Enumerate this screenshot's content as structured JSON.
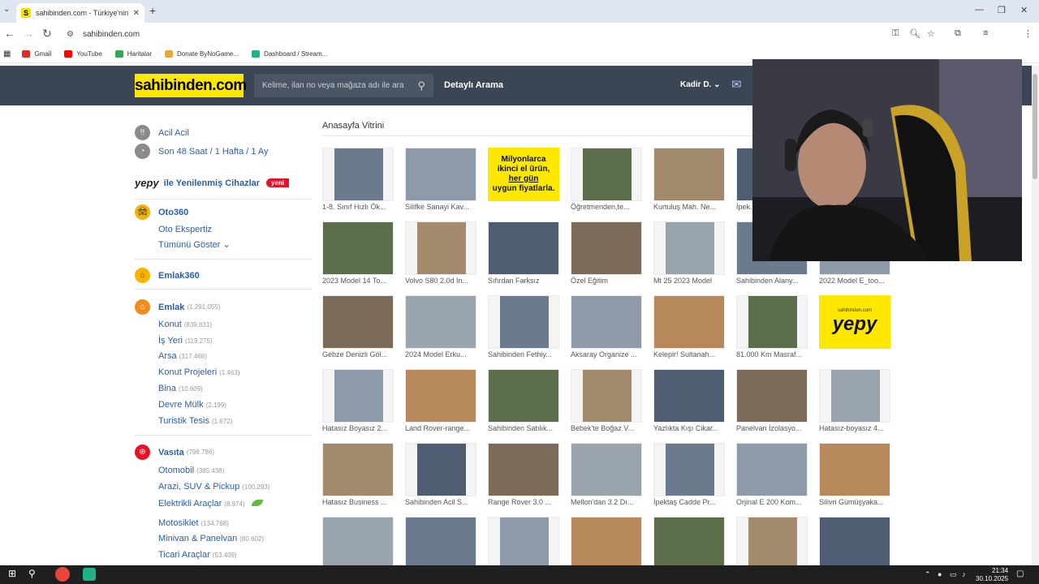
{
  "browser": {
    "tab_title": "sahibinden.com - Türkiye'nin O",
    "tab_favicon": "S",
    "url": "sahibinden.com",
    "bookmarks": [
      {
        "label": "Gmail",
        "color": "#d93025"
      },
      {
        "label": "YouTube",
        "color": "#ff0000"
      },
      {
        "label": "Haritalar",
        "color": "#34a853"
      },
      {
        "label": "Donate ByNoGame...",
        "color": "#e8a93c"
      },
      {
        "label": "Dashboard / Stream...",
        "color": "#1fb28a"
      }
    ]
  },
  "header": {
    "logo": "sahibinden.com",
    "search_placeholder": "Kelime, ilan no veya mağaza adı ile ara",
    "detailed_search": "Detaylı Arama",
    "user_name": "Kadir D."
  },
  "sidebar": {
    "acil": "Acil Acil",
    "son48": "Son 48 Saat / 1 Hafta / 1 Ay",
    "yepy_brand": "yepy",
    "yepy_label": "ile Yenilenmiş Cihazlar",
    "yepy_badge": "yeni",
    "oto360": "Oto360",
    "oto_ekspertiz": "Oto Ekspertiz",
    "tumunu_goster": "Tümünü Göster",
    "emlak360": "Emlak360",
    "emlak": {
      "label": "Emlak",
      "count": "(1.291.055)",
      "items": [
        {
          "label": "Konut",
          "count": "(839.831)"
        },
        {
          "label": "İş Yeri",
          "count": "(119.275)"
        },
        {
          "label": "Arsa",
          "count": "(317.468)"
        },
        {
          "label": "Konut Projeleri",
          "count": "(1.463)"
        },
        {
          "label": "Bina",
          "count": "(10.609)"
        },
        {
          "label": "Devre Mülk",
          "count": "(2.199)"
        },
        {
          "label": "Turistik Tesis",
          "count": "(1.672)"
        }
      ]
    },
    "vasita": {
      "label": "Vasıta",
      "count": "(798.786)",
      "items": [
        {
          "label": "Otomobil",
          "count": "(385.438)"
        },
        {
          "label": "Arazi, SUV & Pickup",
          "count": "(100.293)"
        },
        {
          "label": "Elektrikli Araçlar",
          "count": "(8.974)"
        },
        {
          "label": "Motosiklet",
          "count": "(134.768)"
        },
        {
          "label": "Minivan & Panelvan",
          "count": "(80.602)"
        },
        {
          "label": "Ticari Araçlar",
          "count": "(53.409)"
        }
      ]
    }
  },
  "main": {
    "title": "Anasayfa Vitrini",
    "ad_text": {
      "line1": "Milyonlarca",
      "line2": "ikinci el ürün,",
      "line3": "her gün",
      "line4": "uygun fiyatlarla."
    },
    "yepy_ad": {
      "small": "sahibinden.com",
      "big": "yepy"
    },
    "rows": [
      [
        "1-8. Sınıf Hızlı Ök...",
        "Silifke Sanayi Kav...",
        "",
        "Öğretmenden,te...",
        "Kurtuluş Mah. Ne...",
        "İpek..."
      ],
      [
        "2023 Model 14 To...",
        "Volvo S80 2.0d In...",
        "Sıfırdan Farksız",
        "Özel Eğitim",
        "Mt 25 2023 Model",
        "Sahibinden Alany...",
        "2022 Model E_too..."
      ],
      [
        "Gebze Denizli Göl...",
        "2024 Model Erku...",
        "Sahibinden Fethiy...",
        "Aksaray Organize ...",
        "Kelepir! Sultanah...",
        "81.000 Km Masraf...",
        ""
      ],
      [
        "Hatasız Boyasız 2...",
        "Land Rover-range...",
        "Sahibinden Satılık...",
        "Bebek'te Boğaz V...",
        "Yazlıkta Kışı Cikar...",
        "Panelvan İzolasyo...",
        "Hatasız-boyasız 4..."
      ],
      [
        "Hatasız Business ...",
        "Sahibinden Acil S...",
        "Range Rover 3.0 ...",
        "Mellon'dan 3.2 Dı...",
        "İpektaş Cadde Pr...",
        "Orjinal E 200 Kom...",
        "Silivri Gümüşyaka..."
      ],
      [
        "",
        "",
        "",
        "",
        "",
        "",
        ""
      ]
    ]
  },
  "taskbar": {
    "time": "21:34",
    "date": "30.10.2025"
  }
}
